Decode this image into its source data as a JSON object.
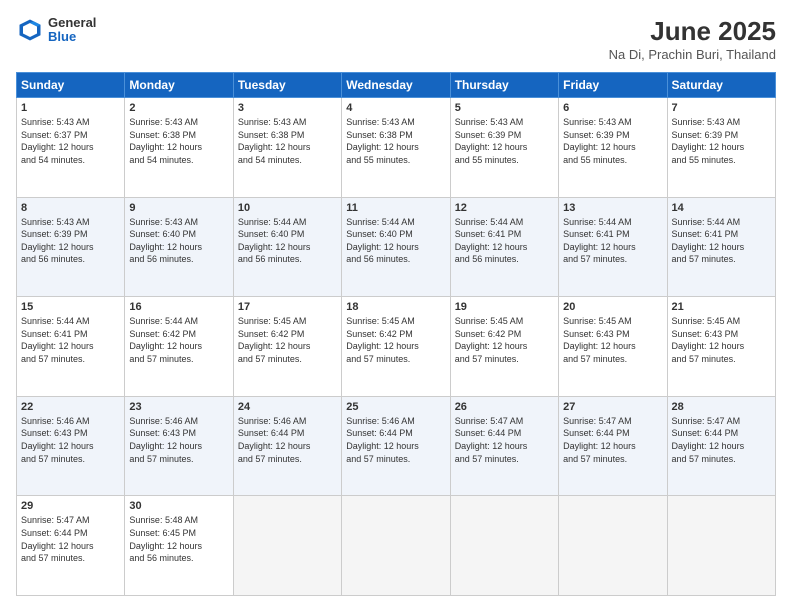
{
  "header": {
    "logo_general": "General",
    "logo_blue": "Blue",
    "title": "June 2025",
    "subtitle": "Na Di, Prachin Buri, Thailand"
  },
  "calendar": {
    "days_of_week": [
      "Sunday",
      "Monday",
      "Tuesday",
      "Wednesday",
      "Thursday",
      "Friday",
      "Saturday"
    ],
    "weeks": [
      [
        {
          "num": "1",
          "info": "Sunrise: 5:43 AM\nSunset: 6:37 PM\nDaylight: 12 hours\nand 54 minutes."
        },
        {
          "num": "2",
          "info": "Sunrise: 5:43 AM\nSunset: 6:38 PM\nDaylight: 12 hours\nand 54 minutes."
        },
        {
          "num": "3",
          "info": "Sunrise: 5:43 AM\nSunset: 6:38 PM\nDaylight: 12 hours\nand 54 minutes."
        },
        {
          "num": "4",
          "info": "Sunrise: 5:43 AM\nSunset: 6:38 PM\nDaylight: 12 hours\nand 55 minutes."
        },
        {
          "num": "5",
          "info": "Sunrise: 5:43 AM\nSunset: 6:39 PM\nDaylight: 12 hours\nand 55 minutes."
        },
        {
          "num": "6",
          "info": "Sunrise: 5:43 AM\nSunset: 6:39 PM\nDaylight: 12 hours\nand 55 minutes."
        },
        {
          "num": "7",
          "info": "Sunrise: 5:43 AM\nSunset: 6:39 PM\nDaylight: 12 hours\nand 55 minutes."
        }
      ],
      [
        {
          "num": "8",
          "info": "Sunrise: 5:43 AM\nSunset: 6:39 PM\nDaylight: 12 hours\nand 56 minutes."
        },
        {
          "num": "9",
          "info": "Sunrise: 5:43 AM\nSunset: 6:40 PM\nDaylight: 12 hours\nand 56 minutes."
        },
        {
          "num": "10",
          "info": "Sunrise: 5:44 AM\nSunset: 6:40 PM\nDaylight: 12 hours\nand 56 minutes."
        },
        {
          "num": "11",
          "info": "Sunrise: 5:44 AM\nSunset: 6:40 PM\nDaylight: 12 hours\nand 56 minutes."
        },
        {
          "num": "12",
          "info": "Sunrise: 5:44 AM\nSunset: 6:41 PM\nDaylight: 12 hours\nand 56 minutes."
        },
        {
          "num": "13",
          "info": "Sunrise: 5:44 AM\nSunset: 6:41 PM\nDaylight: 12 hours\nand 57 minutes."
        },
        {
          "num": "14",
          "info": "Sunrise: 5:44 AM\nSunset: 6:41 PM\nDaylight: 12 hours\nand 57 minutes."
        }
      ],
      [
        {
          "num": "15",
          "info": "Sunrise: 5:44 AM\nSunset: 6:41 PM\nDaylight: 12 hours\nand 57 minutes."
        },
        {
          "num": "16",
          "info": "Sunrise: 5:44 AM\nSunset: 6:42 PM\nDaylight: 12 hours\nand 57 minutes."
        },
        {
          "num": "17",
          "info": "Sunrise: 5:45 AM\nSunset: 6:42 PM\nDaylight: 12 hours\nand 57 minutes."
        },
        {
          "num": "18",
          "info": "Sunrise: 5:45 AM\nSunset: 6:42 PM\nDaylight: 12 hours\nand 57 minutes."
        },
        {
          "num": "19",
          "info": "Sunrise: 5:45 AM\nSunset: 6:42 PM\nDaylight: 12 hours\nand 57 minutes."
        },
        {
          "num": "20",
          "info": "Sunrise: 5:45 AM\nSunset: 6:43 PM\nDaylight: 12 hours\nand 57 minutes."
        },
        {
          "num": "21",
          "info": "Sunrise: 5:45 AM\nSunset: 6:43 PM\nDaylight: 12 hours\nand 57 minutes."
        }
      ],
      [
        {
          "num": "22",
          "info": "Sunrise: 5:46 AM\nSunset: 6:43 PM\nDaylight: 12 hours\nand 57 minutes."
        },
        {
          "num": "23",
          "info": "Sunrise: 5:46 AM\nSunset: 6:43 PM\nDaylight: 12 hours\nand 57 minutes."
        },
        {
          "num": "24",
          "info": "Sunrise: 5:46 AM\nSunset: 6:44 PM\nDaylight: 12 hours\nand 57 minutes."
        },
        {
          "num": "25",
          "info": "Sunrise: 5:46 AM\nSunset: 6:44 PM\nDaylight: 12 hours\nand 57 minutes."
        },
        {
          "num": "26",
          "info": "Sunrise: 5:47 AM\nSunset: 6:44 PM\nDaylight: 12 hours\nand 57 minutes."
        },
        {
          "num": "27",
          "info": "Sunrise: 5:47 AM\nSunset: 6:44 PM\nDaylight: 12 hours\nand 57 minutes."
        },
        {
          "num": "28",
          "info": "Sunrise: 5:47 AM\nSunset: 6:44 PM\nDaylight: 12 hours\nand 57 minutes."
        }
      ],
      [
        {
          "num": "29",
          "info": "Sunrise: 5:47 AM\nSunset: 6:44 PM\nDaylight: 12 hours\nand 57 minutes."
        },
        {
          "num": "30",
          "info": "Sunrise: 5:48 AM\nSunset: 6:45 PM\nDaylight: 12 hours\nand 56 minutes."
        },
        {
          "num": "",
          "info": ""
        },
        {
          "num": "",
          "info": ""
        },
        {
          "num": "",
          "info": ""
        },
        {
          "num": "",
          "info": ""
        },
        {
          "num": "",
          "info": ""
        }
      ]
    ]
  }
}
